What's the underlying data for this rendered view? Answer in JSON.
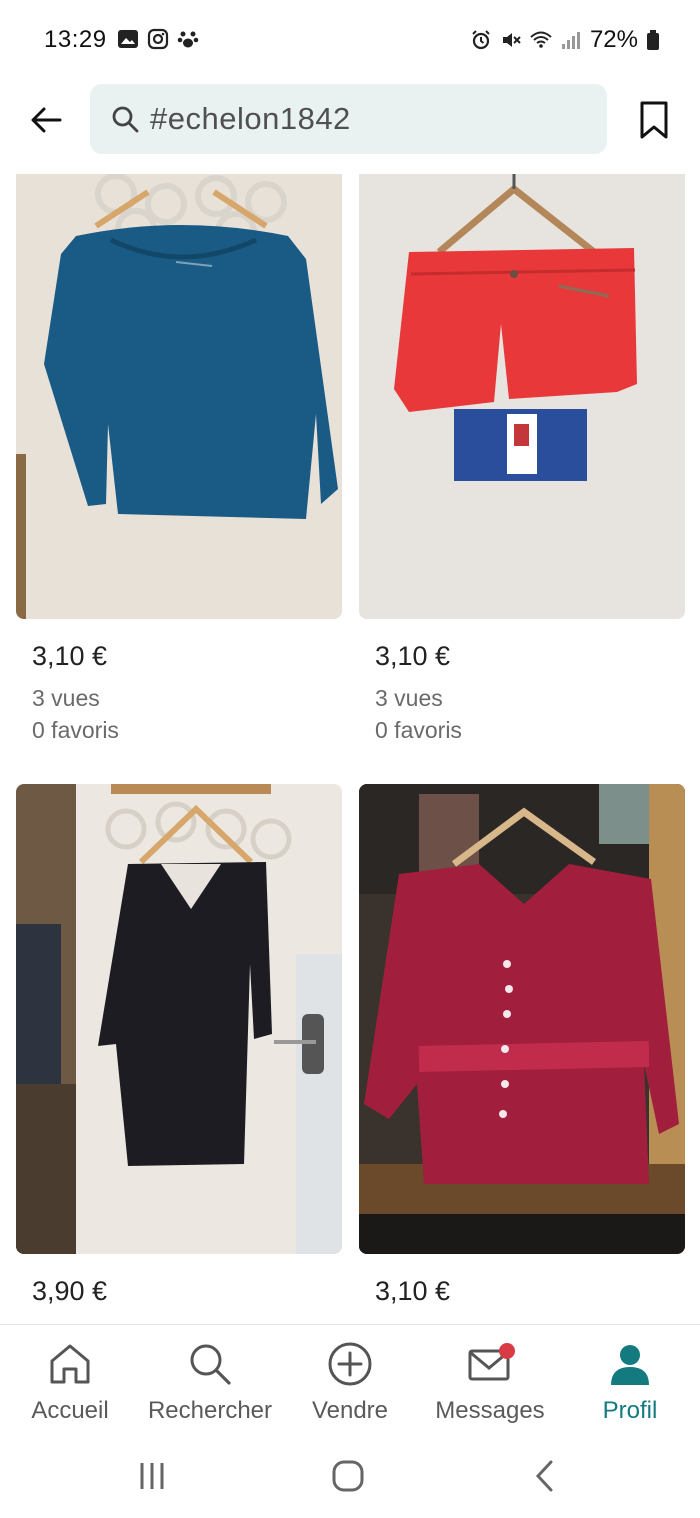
{
  "status_bar": {
    "time": "13:29",
    "left_icons": [
      "gallery-icon",
      "instagram-icon",
      "paw-icon"
    ],
    "right_icons": [
      "alarm-icon",
      "mute-icon",
      "wifi-icon",
      "signal-icon",
      "battery-icon"
    ],
    "battery": "72%"
  },
  "header": {
    "search_query": "#echelon1842",
    "back_icon": "arrow-left-icon",
    "bookmark_icon": "bookmark-icon"
  },
  "listings": [
    {
      "price": "3,10 €",
      "views": "3 vues",
      "favorites": "0 favoris",
      "item": "blue long-sleeve top",
      "colors": {
        "bg": "#e8e1d8",
        "garment": "#1a5b85"
      }
    },
    {
      "price": "3,10 €",
      "views": "3 vues",
      "favorites": "0 favoris",
      "item": "red shorts",
      "colors": {
        "bg": "#e7e3df",
        "garment": "#e8383a"
      }
    },
    {
      "price": "3,90 €",
      "item": "black dress",
      "colors": {
        "bg": "#ece7e0",
        "garment": "#1c1c22"
      }
    },
    {
      "price": "3,10 €",
      "item": "burgundy blouse",
      "colors": {
        "bg": "#3a332d",
        "garment": "#a11f3c"
      }
    }
  ],
  "bottom_nav": {
    "items": [
      {
        "label": "Accueil",
        "icon": "home-icon",
        "active": false
      },
      {
        "label": "Rechercher",
        "icon": "search-icon",
        "active": false
      },
      {
        "label": "Vendre",
        "icon": "plus-circle-icon",
        "active": false
      },
      {
        "label": "Messages",
        "icon": "mail-icon",
        "active": false,
        "badge": true
      },
      {
        "label": "Profil",
        "icon": "profile-icon",
        "active": true
      }
    ],
    "active_color": "#137b80",
    "badge_color": "#d93b45"
  },
  "system_nav": [
    "recents-icon",
    "home-circle-icon",
    "back-chevron-icon"
  ]
}
